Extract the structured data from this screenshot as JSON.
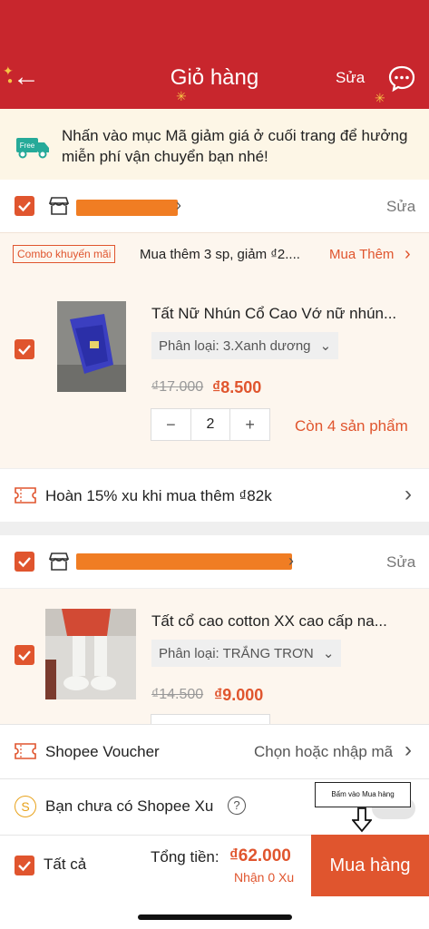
{
  "header": {
    "title": "Giỏ hàng",
    "edit_label": "Sửa"
  },
  "banner": {
    "text": "Nhấn vào mục Mã giảm giá ở cuối trang để hưởng miễn phí vận chuyển bạn nhé!",
    "free_label": "Free"
  },
  "shop1": {
    "edit_label": "Sửa",
    "combo": {
      "tag": "Combo khuyến mãi",
      "text": "Mua thêm 3 sp, giảm ₫2....",
      "more": "Mua Thêm"
    },
    "item": {
      "name": "Tất Nữ Nhún Cổ Cao Vớ nữ nhún...",
      "variant": "Phân loại: 3.Xanh dương",
      "old_price": "₫17.000",
      "price": "₫8.500",
      "quantity": "2",
      "stock": "Còn 4 sản phẩm"
    },
    "cashback": "Hoàn 15% xu khi mua thêm ₫82k"
  },
  "shop2": {
    "edit_label": "Sửa",
    "item": {
      "name": "Tất cổ cao cotton XX cao cấp na...",
      "variant": "Phân loại: TRẮNG TRƠN",
      "old_price": "₫14.500",
      "price": "₫9.000"
    }
  },
  "voucher": {
    "label": "Shopee Voucher",
    "action": "Chọn hoặc nhập mã"
  },
  "xu": {
    "label": "Bạn chưa có Shopee Xu",
    "help": "?"
  },
  "annotation": "Bấm vào Mua hàng",
  "checkout": {
    "select_all": "Tất cả",
    "total_label": "Tổng tiền:",
    "total_value": "₫62.000",
    "xu_earn": "Nhận 0 Xu",
    "buy_label": "Mua hàng"
  },
  "colors": {
    "brand_red": "#c8262d",
    "accent": "#e0552e"
  }
}
